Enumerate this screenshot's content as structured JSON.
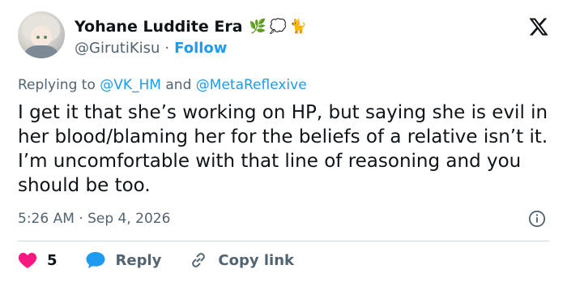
{
  "author": {
    "name": "Yohane Luddite Era",
    "name_emojis": [
      "🌿",
      "💭",
      "🐈"
    ],
    "handle": "@GirutiKisu",
    "separator": "·",
    "follow_label": "Follow"
  },
  "reply": {
    "prefix": "Replying to",
    "mention1": "@VK_HM",
    "conjunction": "and",
    "mention2": "@MetaReflexive"
  },
  "tweet": {
    "text": "I get it that she’s working on HP, but saying she is evil in her blood/blaming her for the beliefs of a relative isn’t it. I’m uncomfortable with that line of reasoning and you should be too.",
    "timestamp": "5:26 AM · Sep 4, 2026"
  },
  "actions": {
    "like_count": "5",
    "reply_label": "Reply",
    "copy_link_label": "Copy link"
  },
  "icons": {
    "brand": "x-logo-icon",
    "info": "info-icon",
    "like": "heart-icon",
    "reply": "speech-bubble-icon",
    "link": "link-icon"
  },
  "colors": {
    "accent": "#1d9bf0",
    "like": "#f91880",
    "muted": "#536471",
    "text": "#0f1419",
    "divider": "#cfd9de"
  }
}
